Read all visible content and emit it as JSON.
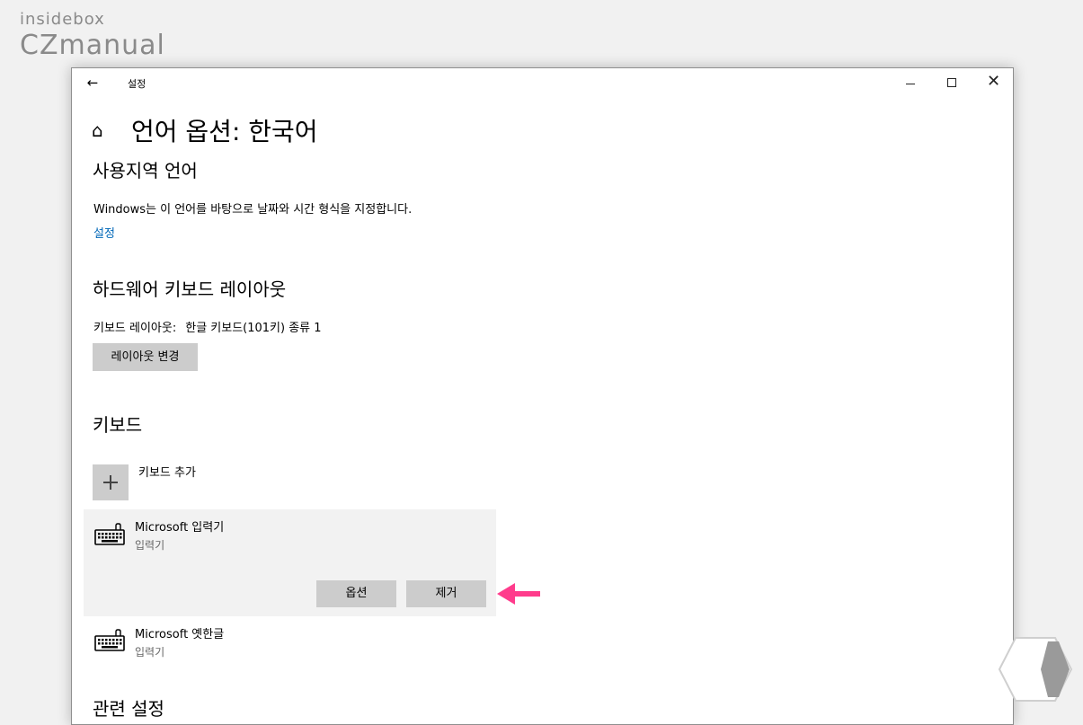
{
  "watermark": {
    "line1": "insidebox",
    "line2": "CZmanual"
  },
  "window": {
    "title": "설정",
    "back_icon": "back-arrow-icon",
    "controls": [
      "minimize-icon",
      "maximize-icon",
      "close-icon"
    ]
  },
  "page": {
    "home_icon": "home-icon",
    "title": "언어 옵션: 한국어"
  },
  "region_language": {
    "heading": "사용지역 언어",
    "description": "Windows는 이 언어를 바탕으로 날짜와 시간 형식을 지정합니다.",
    "link": "설정"
  },
  "hardware_keyboard": {
    "heading": "하드웨어 키보드 레이아웃",
    "layout_label": "키보드 레이아웃:",
    "layout_value": "한글 키보드(101키) 종류 1",
    "change_button": "레이아웃 변경"
  },
  "keyboards": {
    "heading": "키보드",
    "add_label": "키보드 추가",
    "items": [
      {
        "name": "Microsoft 입력기",
        "type": "입력기",
        "icon": "keyboard-icon",
        "selected": true,
        "buttons": {
          "options": "옵션",
          "remove": "제거"
        }
      },
      {
        "name": "Microsoft 옛한글",
        "type": "입력기",
        "icon": "keyboard-icon",
        "selected": false
      }
    ]
  },
  "related_settings": {
    "heading": "관련 설정"
  },
  "annotation": {
    "arrow_icon": "left-arrow-icon",
    "arrow_color": "#ff3c8c"
  },
  "colors": {
    "link": "#0067b8",
    "button_bg": "#cccccc",
    "selected_item_bg": "#f2f2f2",
    "desktop_bg": "#f1f1f1"
  }
}
